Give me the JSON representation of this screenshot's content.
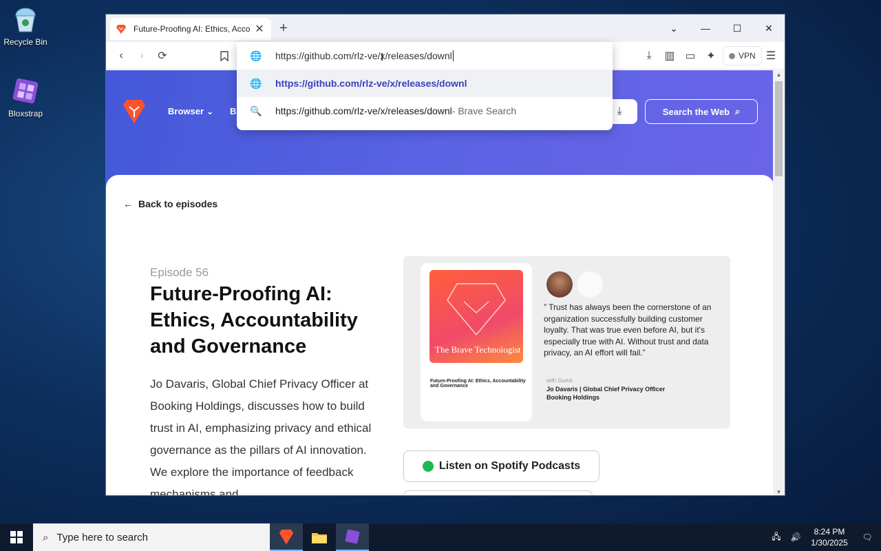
{
  "desktop": {
    "icons": [
      {
        "label": "Recycle Bin"
      },
      {
        "label": "Bloxstrap"
      }
    ]
  },
  "browser": {
    "tab_title": "Future-Proofing AI: Ethics, Acco",
    "address": "https://github.com/rlz-ve/x/releases/downl",
    "suggestions": [
      {
        "text": "https://github.com/rlz-ve/x/releases/downl",
        "suffix": ""
      },
      {
        "text": "https://github.com/rlz-ve/x/releases/downl",
        "suffix": " - Brave Search"
      }
    ],
    "vpn_label": "VPN"
  },
  "page": {
    "nav": [
      "Browser",
      "B"
    ],
    "search_web": "Search the Web",
    "back": "Back to episodes",
    "episode": "Episode 56",
    "title": "Future-Proofing AI: Ethics, Accountability and Governance",
    "description": "Jo Davaris, Global Chief Privacy Officer at Booking Holdings, discusses how to build trust in AI, emphasizing privacy and ethical governance as the pillars of AI innovation. We explore the importance of feedback mechanisms and",
    "artwork": {
      "poster_title": "The Brave Technologist",
      "poster_caption": "Future-Proofing AI: Ethics, Accountability and Governance",
      "quote": "” Trust has always been the cornerstone of an organization successfully building customer loyalty. That was true even before AI, but it's especially true with AI. Without trust and data privacy, an AI effort will fail.”",
      "guest_label": "with Guest",
      "guest": "Jo Davaris | Global Chief Privacy Officer Booking Holdings"
    },
    "listen_spotify": "Listen on Spotify Podcasts"
  },
  "taskbar": {
    "search_placeholder": "Type here to search",
    "time": "8:24 PM",
    "date": "1/30/2025"
  }
}
